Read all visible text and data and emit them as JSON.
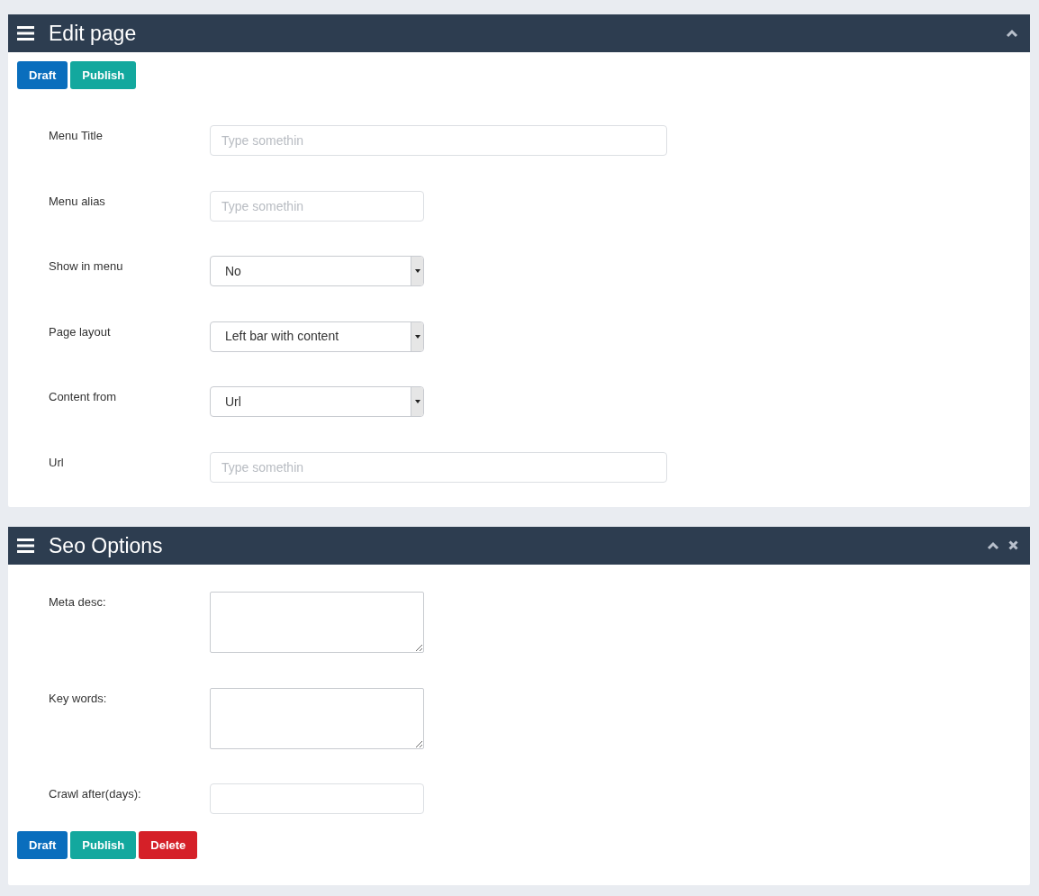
{
  "panels": [
    {
      "title": "Edit page",
      "closable": false,
      "top_buttons": [
        {
          "label": "Draft",
          "kind": "draft"
        },
        {
          "label": "Publish",
          "kind": "publish"
        }
      ],
      "fields": [
        {
          "kind": "wide_input",
          "label": "Menu Title",
          "placeholder": "Type somethin"
        },
        {
          "kind": "input",
          "label": "Menu alias",
          "placeholder": "Type somethin"
        },
        {
          "kind": "select",
          "label": "Show in menu",
          "value": "No"
        },
        {
          "kind": "select",
          "label": "Page layout",
          "value": "Left bar with content"
        },
        {
          "kind": "select",
          "label": "Content from",
          "value": "Url"
        },
        {
          "kind": "wide_input",
          "label": "Url",
          "placeholder": "Type somethin"
        }
      ]
    },
    {
      "title": "Seo Options",
      "closable": true,
      "fields": [
        {
          "kind": "textarea",
          "label": "Meta desc:"
        },
        {
          "kind": "textarea",
          "label": "Key words:"
        },
        {
          "kind": "input",
          "label": "Crawl after(days):"
        }
      ],
      "bottom_buttons": [
        {
          "label": "Draft",
          "kind": "draft"
        },
        {
          "label": "Publish",
          "kind": "publish"
        },
        {
          "label": "Delete",
          "kind": "delete"
        }
      ]
    }
  ]
}
